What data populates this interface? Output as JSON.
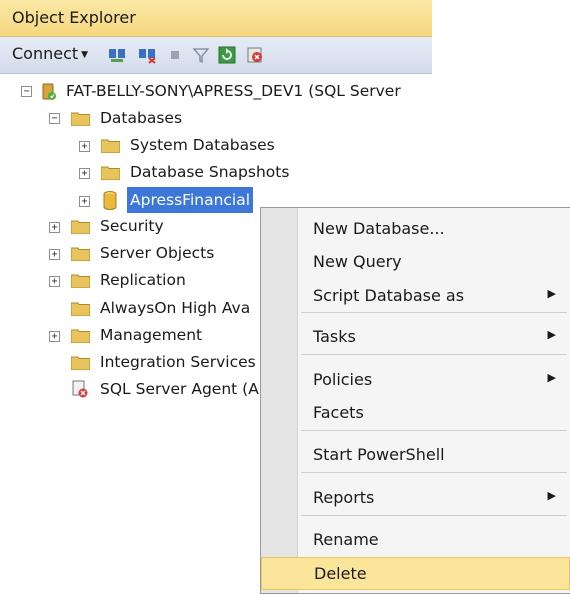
{
  "window": {
    "title": "Object Explorer"
  },
  "toolbar": {
    "connect_label": "Connect",
    "icons": [
      "connect-object-explorer-icon",
      "disconnect-icon",
      "stop-icon",
      "filter-icon",
      "refresh-icon",
      "activity-monitor-icon"
    ]
  },
  "tree": {
    "server": "FAT-BELLY-SONY\\APRESS_DEV1 (SQL Server",
    "databases": "Databases",
    "system_databases": "System Databases",
    "database_snapshots": "Database Snapshots",
    "apress_financial": "ApressFinancial",
    "security": "Security",
    "server_objects": "Server Objects",
    "replication": "Replication",
    "alwayson": "AlwaysOn High Ava",
    "management": "Management",
    "integration_services": "Integration Services",
    "sql_server_agent": "SQL Server Agent (A"
  },
  "context_menu": {
    "new_database": "New Database...",
    "new_query": "New Query",
    "script_database_as": "Script Database as",
    "tasks": "Tasks",
    "policies": "Policies",
    "facets": "Facets",
    "start_powershell": "Start PowerShell",
    "reports": "Reports",
    "rename": "Rename",
    "delete": "Delete",
    "highlighted_item": "delete"
  },
  "colors": {
    "title_bg": "#f5d77f",
    "toolbar_bg": "#d3dcec",
    "selection": "#3d78d8",
    "menu_highlight": "#fbe59b"
  }
}
